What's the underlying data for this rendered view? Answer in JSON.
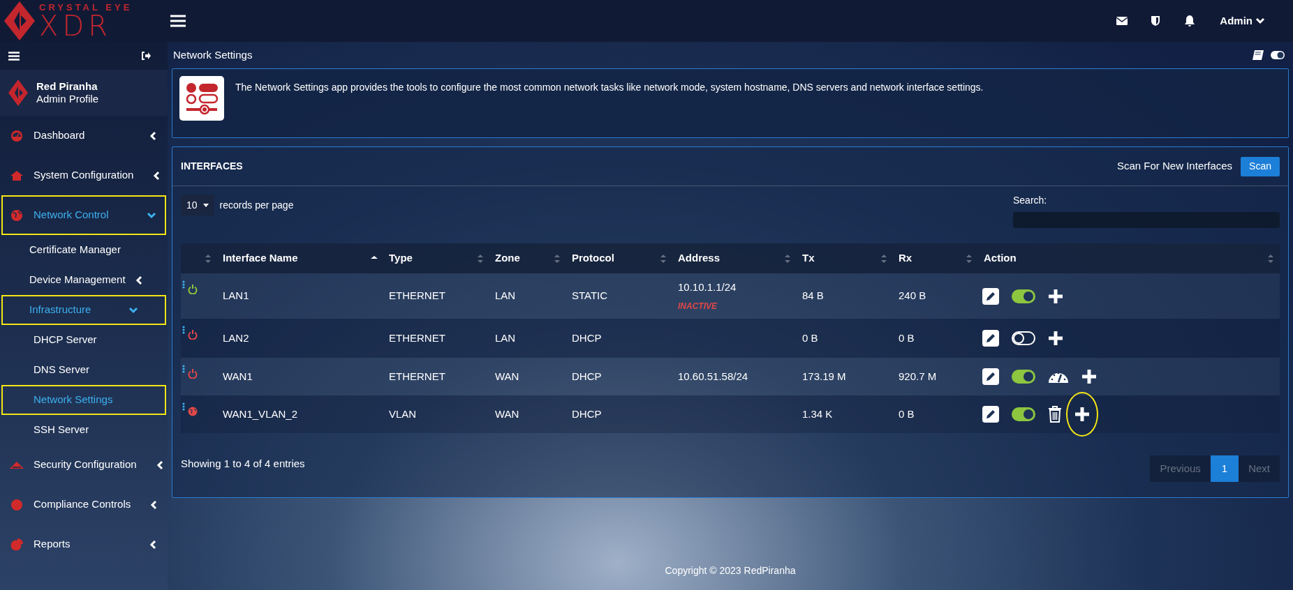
{
  "logo": {
    "brand": "CRYSTAL EYE",
    "product": "XDR"
  },
  "top_bar": {
    "user": "Admin"
  },
  "sidebar": {
    "profile": {
      "name": "Red Piranha",
      "role": "Admin Profile"
    },
    "items": [
      {
        "label": "Dashboard",
        "expanded": false,
        "highlighted": false
      },
      {
        "label": "System Configuration",
        "expanded": false,
        "highlighted": false
      },
      {
        "label": "Network Control",
        "expanded": true,
        "highlighted": true,
        "children": [
          {
            "label": "Certificate Manager",
            "selected": false,
            "highlighted": false
          },
          {
            "label": "Device Management",
            "expanded": false,
            "highlighted": false
          },
          {
            "label": "Infrastructure",
            "expanded": true,
            "highlighted": true,
            "children": [
              {
                "label": "DHCP Server",
                "selected": false,
                "highlighted": false
              },
              {
                "label": "DNS Server",
                "selected": false,
                "highlighted": false
              },
              {
                "label": "Network Settings",
                "selected": true,
                "highlighted": true
              },
              {
                "label": "SSH Server",
                "selected": false,
                "highlighted": false
              }
            ]
          }
        ]
      },
      {
        "label": "Security Configuration",
        "expanded": false,
        "highlighted": false
      },
      {
        "label": "Compliance Controls",
        "expanded": false,
        "highlighted": false
      },
      {
        "label": "Reports",
        "expanded": false,
        "highlighted": false
      }
    ]
  },
  "page": {
    "title": "Network Settings",
    "description": "The Network Settings app provides the tools to configure the most common network tasks like network mode, system hostname, DNS servers and network interface settings."
  },
  "interfaces": {
    "title": "INTERFACES",
    "scan_label": "Scan For New Interfaces",
    "scan_button": "Scan",
    "page_length": "10",
    "page_length_label": "records per page",
    "search_label": "Search:",
    "table": {
      "columns": [
        {
          "sorted": false
        },
        {
          "label": "Interface Name",
          "sorted": true
        },
        {
          "label": "Type",
          "sorted": false
        },
        {
          "label": "Zone",
          "sorted": false
        },
        {
          "label": "Protocol",
          "sorted": false
        },
        {
          "label": "Address",
          "sorted": false
        },
        {
          "label": "Tx",
          "sorted": false
        },
        {
          "label": "Rx",
          "sorted": false
        },
        {
          "label": "Action",
          "sorted": false
        }
      ],
      "rows": [
        {
          "kind": "power",
          "up": true,
          "name": "LAN1",
          "type": "ETHERNET",
          "zone": "LAN",
          "protocol": "STATIC",
          "address": "10.10.1.1/24",
          "address_status": "INACTIVE",
          "tx": "84 B",
          "rx": "240 B",
          "actions": [
            {
              "kind": "edit"
            },
            {
              "kind": "toggle",
              "on": true
            },
            {
              "kind": "add"
            }
          ]
        },
        {
          "kind": "power",
          "up": false,
          "name": "LAN2",
          "type": "ETHERNET",
          "zone": "LAN",
          "protocol": "DHCP",
          "tx": "0 B",
          "rx": "0 B",
          "actions": [
            {
              "kind": "edit"
            },
            {
              "kind": "toggle",
              "on": false
            },
            {
              "kind": "add"
            }
          ]
        },
        {
          "kind": "power",
          "up": false,
          "name": "WAN1",
          "type": "ETHERNET",
          "zone": "WAN",
          "protocol": "DHCP",
          "address": "10.60.51.58/24",
          "tx": "173.19 M",
          "rx": "920.7 M",
          "actions": [
            {
              "kind": "edit"
            },
            {
              "kind": "toggle",
              "on": true
            },
            {
              "kind": "gauge"
            },
            {
              "kind": "add"
            }
          ]
        },
        {
          "kind": "vlan",
          "up": false,
          "name": "WAN1_VLAN_2",
          "type": "VLAN",
          "zone": "WAN",
          "protocol": "DHCP",
          "tx": "1.34 K",
          "rx": "0 B",
          "actions": [
            {
              "kind": "edit"
            },
            {
              "kind": "toggle",
              "on": true
            },
            {
              "kind": "delete"
            },
            {
              "kind": "add",
              "circled": true
            }
          ]
        }
      ]
    },
    "info": "Showing 1 to 4 of 4 entries",
    "pagination": [
      {
        "label": "Previous",
        "selected": false
      },
      {
        "label": "1",
        "selected": true
      },
      {
        "label": "Next",
        "selected": false
      }
    ]
  },
  "footer": "Copyright © 2023 RedPiranha"
}
